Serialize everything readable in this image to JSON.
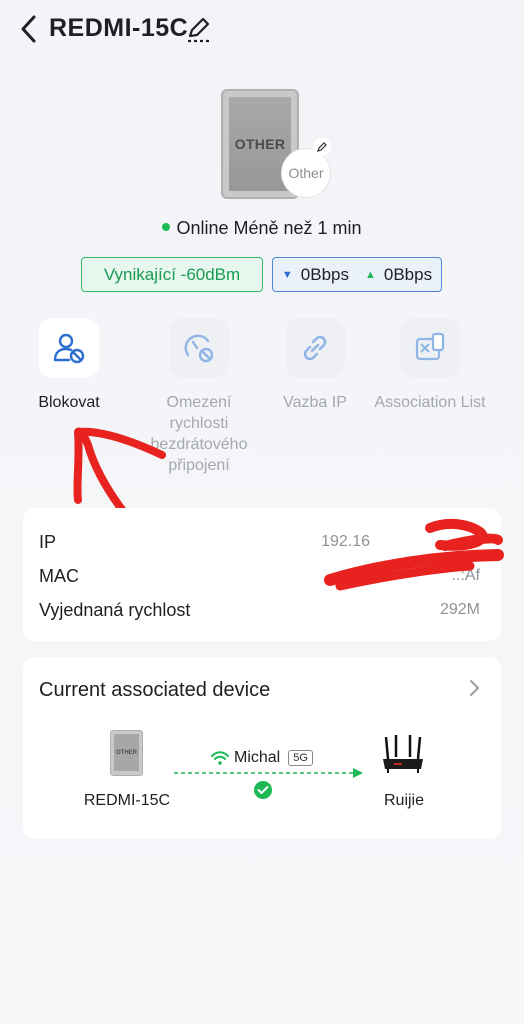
{
  "header": {
    "title": "REDMI-15C",
    "back_icon": "chevron-left-icon",
    "edit_icon": "pencil-icon"
  },
  "device": {
    "image_label": "OTHER",
    "type_badge": "Other"
  },
  "status": {
    "text": "Online Méně než 1 min",
    "dot_color": "#1db954"
  },
  "signal": {
    "label": "Vynikající -60dBm",
    "color": "#33b86a"
  },
  "speed": {
    "down": "0Bbps",
    "up": "0Bbps"
  },
  "actions": [
    {
      "label": "Blokovat",
      "icon": "user-block-icon",
      "enabled": true
    },
    {
      "label": "Omezení rychlosti bezdrátového připojení",
      "icon": "speed-limit-icon",
      "enabled": false
    },
    {
      "label": "Vazba IP",
      "icon": "link-icon",
      "enabled": false
    },
    {
      "label": "Association List",
      "icon": "association-list-icon",
      "enabled": false
    }
  ],
  "info": {
    "rows": [
      {
        "label": "IP",
        "value": "192.16"
      },
      {
        "label": "MAC",
        "value": "..:Af"
      },
      {
        "label": "Vyjednaná rychlost",
        "value": "292M"
      }
    ]
  },
  "associated": {
    "title": "Current associated device",
    "client_name": "REDMI-15C",
    "client_image_label": "OTHER",
    "ssid": "Michal",
    "band": "5G",
    "router_name": "Ruijie"
  }
}
